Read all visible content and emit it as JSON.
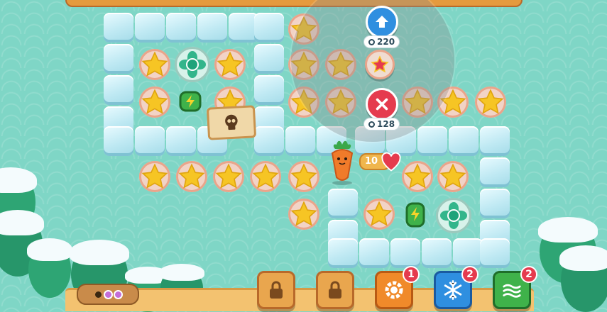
{
  "game": {
    "lives": {
      "value": "10"
    },
    "booster_popup": {
      "arrow_price": "220",
      "cancel_price": "128"
    },
    "toolbar": {
      "bomb_count": "1",
      "freeze_count": "2",
      "wind_count": "2"
    },
    "colors": {
      "star": "#f6c524",
      "tile": "#bfe9f3",
      "accent": "#e53b4e"
    }
  }
}
